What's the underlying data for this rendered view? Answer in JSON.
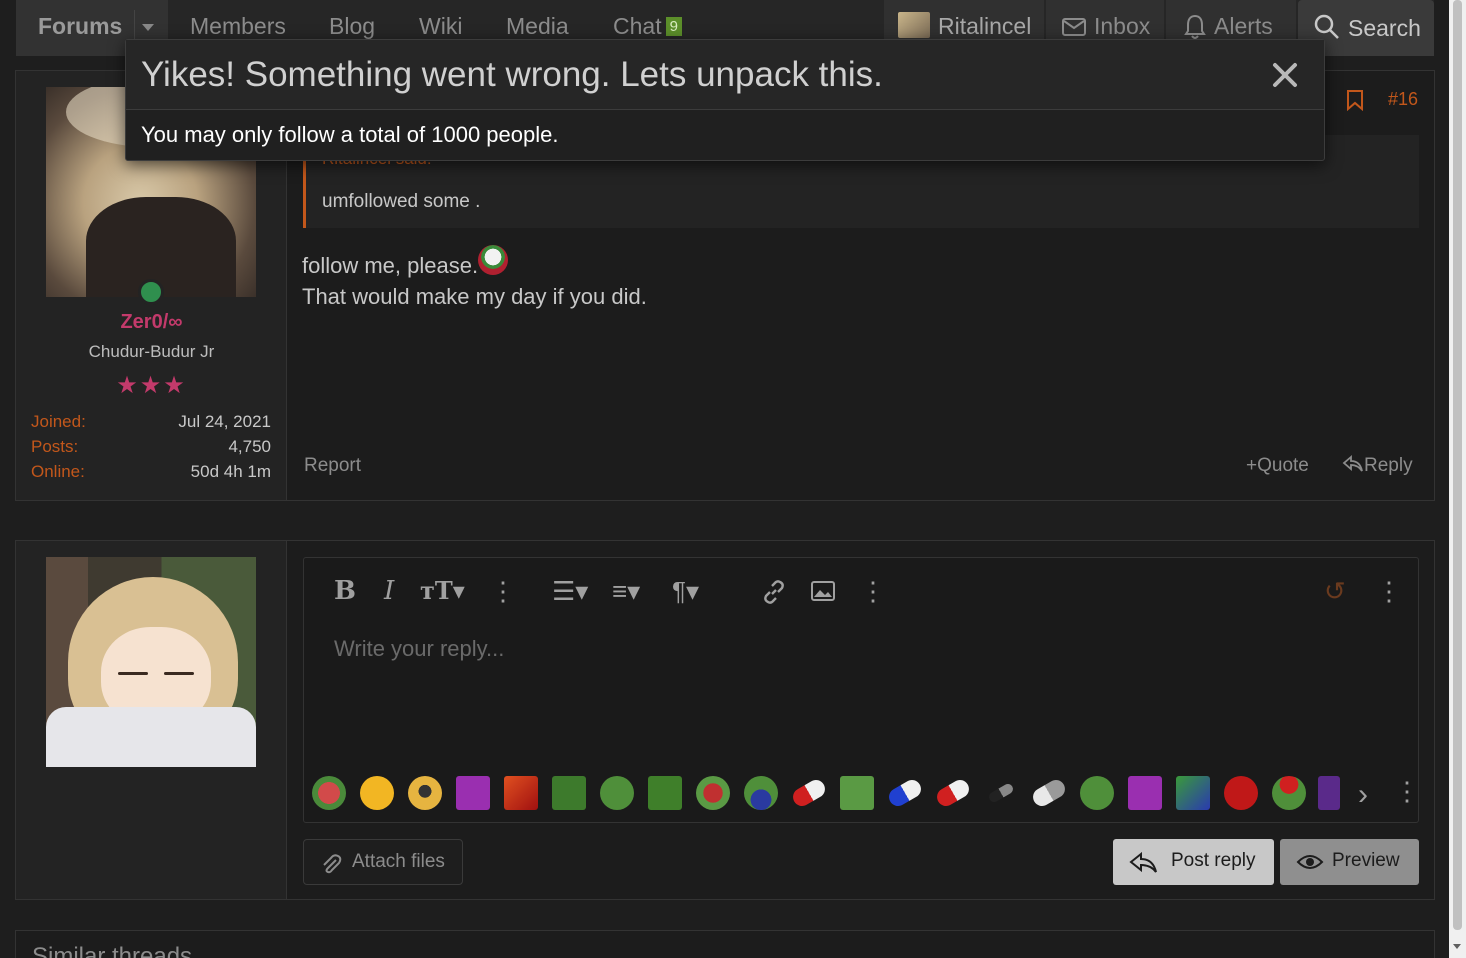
{
  "nav": {
    "forums": "Forums",
    "members": "Members",
    "blog": "Blog",
    "wiki": "Wiki",
    "media": "Media",
    "chat": "Chat",
    "chat_badge": "9",
    "user": "Ritalincel",
    "inbox": "Inbox",
    "alerts": "Alerts",
    "search": "Search"
  },
  "modal": {
    "title": "Yikes! Something went wrong. Lets unpack this.",
    "message": "You may only follow a total of 1000 people."
  },
  "post": {
    "number": "#16",
    "author": "Zer0/∞",
    "user_title": "Chudur-Budur Jr",
    "stars": "★★★",
    "stats": [
      {
        "label": "Joined:",
        "value": "Jul 24, 2021"
      },
      {
        "label": "Posts:",
        "value": "4,750"
      },
      {
        "label": "Online:",
        "value": "50d 4h 1m"
      }
    ],
    "quote_author": "Ritalincel said:",
    "quote_text": "umfollowed some .",
    "message_line1": "follow me, please.",
    "message_line2": "That would make my day if you did.",
    "report": "Report",
    "quote_btn": "Quote",
    "reply_btn": "Reply"
  },
  "reply_form": {
    "placeholder": "Write your reply...",
    "attach": "Attach files",
    "post_reply": "Post reply",
    "preview": "Preview"
  },
  "similar": {
    "title": "Similar threads"
  },
  "colors": {
    "accent": "#c2571b",
    "username": "#c33a6b",
    "online": "#2f8f4e"
  }
}
